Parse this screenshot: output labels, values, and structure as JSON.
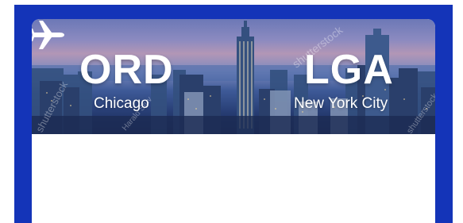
{
  "flight": {
    "origin_code": "ORD",
    "origin_city": "Chicago",
    "destination_code": "LGA",
    "destination_city": "New York City"
  },
  "icons": {
    "plane": "airplane-icon"
  },
  "watermarks": [
    "shutterstock",
    "shutterstock",
    "Harald Stuv",
    "shutterstock"
  ],
  "colors": {
    "frame": "#1434b8",
    "card": "#ffffff",
    "text": "#ffffff"
  }
}
